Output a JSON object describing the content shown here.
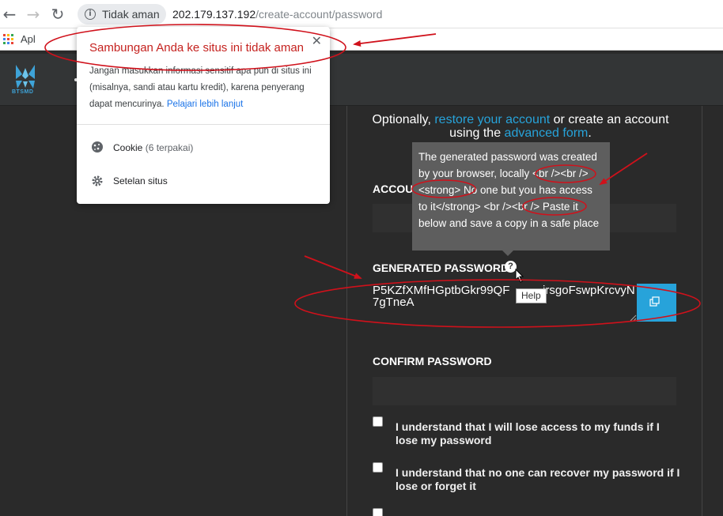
{
  "browser": {
    "security_chip": "Tidak aman",
    "url_host": "202.179.137.192",
    "url_path": "/create-account/password",
    "bookmarks_label": "Apl"
  },
  "popup": {
    "title": "Sambungan Anda ke situs ini tidak aman",
    "body": "Jangan masukkan informasi sensitif apa pun di situs ini (misalnya, sandi atau kartu kredit), karena penyerang dapat mencurinya.",
    "learn_more": "Pelajari lebih lanjut",
    "cookie_label": "Cookie",
    "cookie_count": "(6 terpakai)",
    "site_settings": "Setelan situs"
  },
  "app": {
    "logo_text": "BTSMD"
  },
  "form": {
    "optional_text_1": "Optionally, ",
    "restore_link": "restore your account",
    "optional_text_2": " or create an account using the ",
    "advanced_link": "advanced form",
    "optional_text_3": ".",
    "account_label": "ACCOU",
    "tooltip_text": "The generated password was created by your browser, locally <br /><br /><strong> No one but you has access to it</strong> <br /><br /> Paste it below and save a copy in a safe place",
    "generated_label": "GENERATED PASSWORD",
    "help_symbol": "?",
    "help_tip": "Help",
    "generated_value": "P5KZfXMfHGptbGkr99QF          irsgoFswpKrcvyN7gTneA",
    "confirm_label": "CONFIRM PASSWORD",
    "checkbox_1": "I understand that I will lose access to my funds if I lose my password",
    "checkbox_2": "I understand that no one can recover my password if I lose or forget it"
  },
  "colors": {
    "accent": "#27a3da",
    "annotation": "#d0111b",
    "popup_title": "#c5221f"
  }
}
